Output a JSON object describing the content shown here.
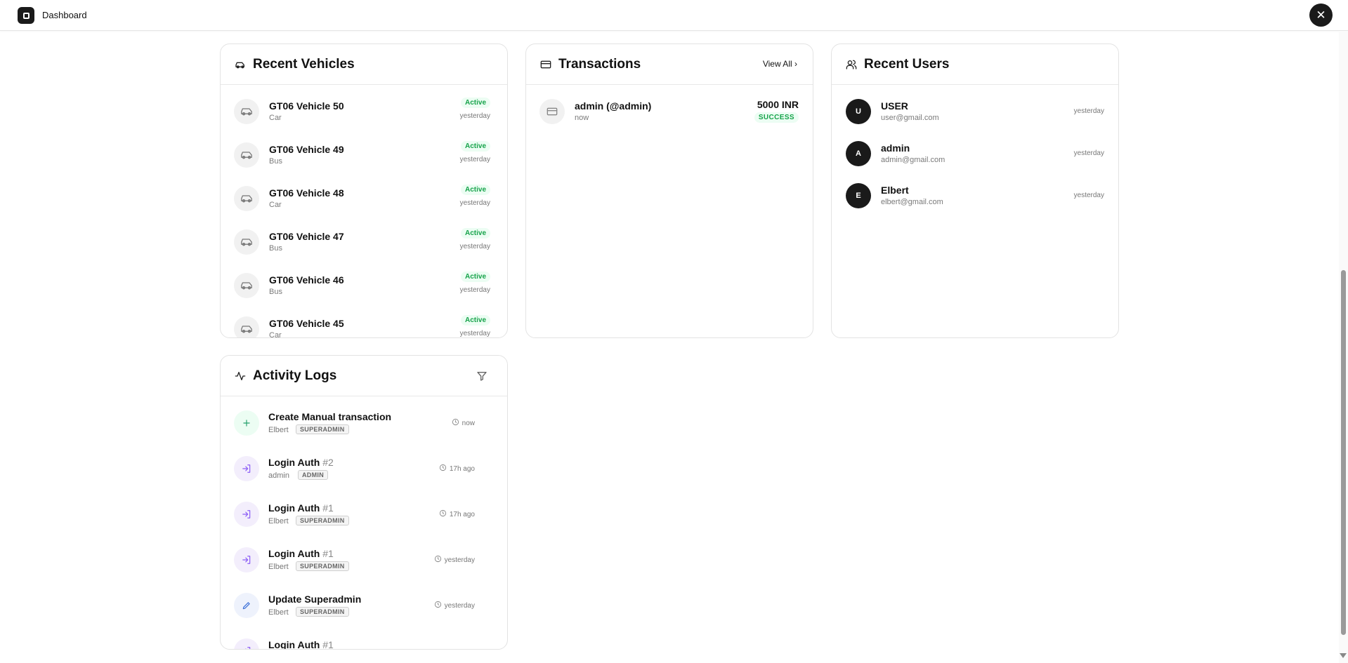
{
  "app": {
    "title": "Dashboard"
  },
  "vehicles": {
    "title": "Recent Vehicles",
    "items": [
      {
        "name": "GT06 Vehicle 50",
        "type": "Car",
        "status": "Active",
        "time": "yesterday"
      },
      {
        "name": "GT06 Vehicle 49",
        "type": "Bus",
        "status": "Active",
        "time": "yesterday"
      },
      {
        "name": "GT06 Vehicle 48",
        "type": "Car",
        "status": "Active",
        "time": "yesterday"
      },
      {
        "name": "GT06 Vehicle 47",
        "type": "Bus",
        "status": "Active",
        "time": "yesterday"
      },
      {
        "name": "GT06 Vehicle 46",
        "type": "Bus",
        "status": "Active",
        "time": "yesterday"
      },
      {
        "name": "GT06 Vehicle 45",
        "type": "Car",
        "status": "Active",
        "time": "yesterday"
      }
    ]
  },
  "transactions": {
    "title": "Transactions",
    "view_all": "View All",
    "items": [
      {
        "name": "admin (@admin)",
        "time": "now",
        "amount": "5000 INR",
        "status": "SUCCESS"
      }
    ]
  },
  "users": {
    "title": "Recent Users",
    "items": [
      {
        "initial": "U",
        "name": "USER",
        "email": "user@gmail.com",
        "time": "yesterday"
      },
      {
        "initial": "A",
        "name": "admin",
        "email": "admin@gmail.com",
        "time": "yesterday"
      },
      {
        "initial": "E",
        "name": "Elbert",
        "email": "elbert@gmail.com",
        "time": "yesterday"
      }
    ]
  },
  "activity": {
    "title": "Activity Logs",
    "items": [
      {
        "action": "Create Manual transaction",
        "num": "",
        "user": "Elbert",
        "role": "SUPERADMIN",
        "time": "now",
        "icon": "plus-icon",
        "color": "green"
      },
      {
        "action": "Login Auth",
        "num": "#2",
        "user": "admin",
        "role": "ADMIN",
        "time": "17h ago",
        "icon": "login-icon",
        "color": "purple"
      },
      {
        "action": "Login Auth",
        "num": "#1",
        "user": "Elbert",
        "role": "SUPERADMIN",
        "time": "17h ago",
        "icon": "login-icon",
        "color": "purple"
      },
      {
        "action": "Login Auth",
        "num": "#1",
        "user": "Elbert",
        "role": "SUPERADMIN",
        "time": "yesterday",
        "icon": "login-icon",
        "color": "purple"
      },
      {
        "action": "Update Superadmin",
        "num": "",
        "user": "Elbert",
        "role": "SUPERADMIN",
        "time": "yesterday",
        "icon": "pencil-icon",
        "color": "blue"
      },
      {
        "action": "Login Auth",
        "num": "#1",
        "user": "",
        "role": "",
        "time": "",
        "icon": "login-icon",
        "color": "purple"
      }
    ]
  },
  "colors": {
    "success": "#16a34a",
    "success_bg": "#ecfdf3",
    "dark": "#1a1a1a"
  }
}
